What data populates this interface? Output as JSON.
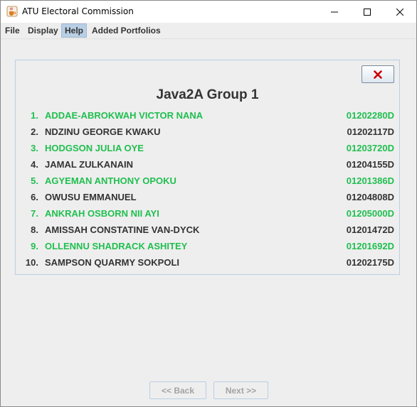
{
  "window": {
    "title": "ATU Electoral Commission",
    "controls": {
      "minimize": "minimize-icon",
      "maximize": "maximize-icon",
      "close": "close-icon"
    }
  },
  "menu": {
    "items": [
      {
        "label": "File",
        "active": false
      },
      {
        "label": "Display",
        "active": false
      },
      {
        "label": "Help",
        "active": true
      },
      {
        "label": "Added Portfolios",
        "active": false
      }
    ]
  },
  "panel": {
    "title": "Java2A Group 1",
    "close_icon": "x-icon",
    "members": [
      {
        "num": "1.",
        "name": "ADDAE-ABROKWAH VICTOR NANA",
        "id": "01202280D",
        "highlight": true
      },
      {
        "num": "2.",
        "name": "NDZINU GEORGE KWAKU",
        "id": "01202117D",
        "highlight": false
      },
      {
        "num": "3.",
        "name": "HODGSON JULIA OYE",
        "id": "01203720D",
        "highlight": true
      },
      {
        "num": "4.",
        "name": "JAMAL ZULKANAIN",
        "id": "01204155D",
        "highlight": false
      },
      {
        "num": "5.",
        "name": "AGYEMAN ANTHONY OPOKU",
        "id": "01201386D",
        "highlight": true
      },
      {
        "num": "6.",
        "name": "OWUSU EMMANUEL",
        "id": "01204808D",
        "highlight": false
      },
      {
        "num": "7.",
        "name": "ANKRAH OSBORN NII AYI",
        "id": "01205000D",
        "highlight": true
      },
      {
        "num": "8.",
        "name": "AMISSAH CONSTATINE VAN-DYCK",
        "id": "01201472D",
        "highlight": false
      },
      {
        "num": "9.",
        "name": "OLLENNU SHADRACK ASHITEY",
        "id": "01201692D",
        "highlight": true
      },
      {
        "num": "10.",
        "name": "SAMPSON QUARMY SOKPOLI",
        "id": "01202175D",
        "highlight": false
      }
    ]
  },
  "nav": {
    "back_label": "<< Back",
    "next_label": "Next >>",
    "back_enabled": false,
    "next_enabled": false
  },
  "colors": {
    "highlight_text": "#1fbf4f",
    "normal_text": "#333333",
    "close_x": "#cc0000",
    "menu_active_bg": "#b8cfe5"
  }
}
